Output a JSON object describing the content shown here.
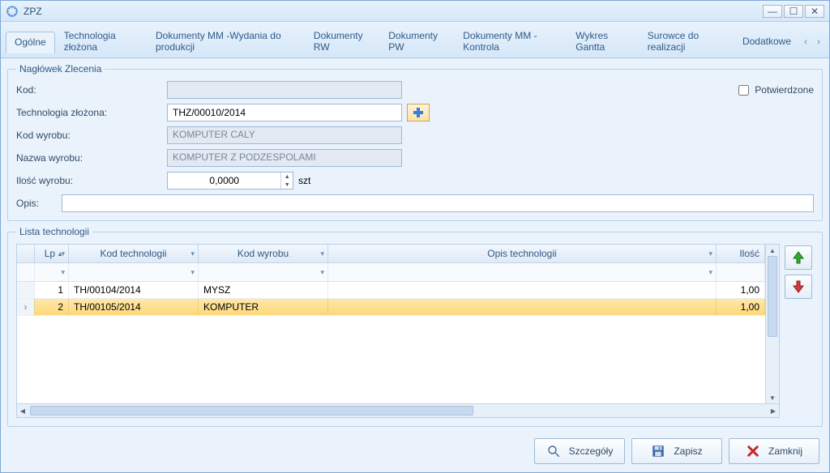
{
  "window": {
    "title": "ZPZ"
  },
  "tabs": {
    "items": [
      "Ogólne",
      "Technologia złożona",
      "Dokumenty MM -Wydania do produkcji",
      "Dokumenty RW",
      "Dokumenty PW",
      "Dokumenty MM - Kontrola",
      "Wykres Gantta",
      "Surowce do realizacji",
      "Dodatkowe"
    ],
    "active": 0
  },
  "header": {
    "legend": "Nagłówek Zlecenia",
    "kod_label": "Kod:",
    "kod_value": "",
    "tech_label": "Technologia złożona:",
    "tech_value": "THZ/00010/2014",
    "kodwyr_label": "Kod wyrobu:",
    "kodwyr_value": "KOMPUTER CALY",
    "nazwa_label": "Nazwa wyrobu:",
    "nazwa_value": "KOMPUTER Z PODZESPOLAMI",
    "ilosc_label": "Ilość wyrobu:",
    "ilosc_value": "0,0000",
    "ilosc_unit": "szt",
    "opis_label": "Opis:",
    "opis_value": "",
    "confirm_label": "Potwierdzone",
    "confirm_checked": false
  },
  "list": {
    "legend": "Lista technologii",
    "columns": {
      "lp": "Lp",
      "kod": "Kod technologii",
      "wyrob": "Kod wyrobu",
      "opis": "Opis technologii",
      "ilosc": "Ilość"
    },
    "rows": [
      {
        "lp": "1",
        "kod": "TH/00104/2014",
        "wyrob": "MYSZ",
        "opis": "",
        "ilosc": "1,00",
        "selected": false,
        "indicator": ""
      },
      {
        "lp": "2",
        "kod": "TH/00105/2014",
        "wyrob": "KOMPUTER",
        "opis": "",
        "ilosc": "1,00",
        "selected": true,
        "indicator": "›"
      }
    ]
  },
  "footer": {
    "details": "Szczegóły",
    "save": "Zapisz",
    "close": "Zamknij"
  }
}
